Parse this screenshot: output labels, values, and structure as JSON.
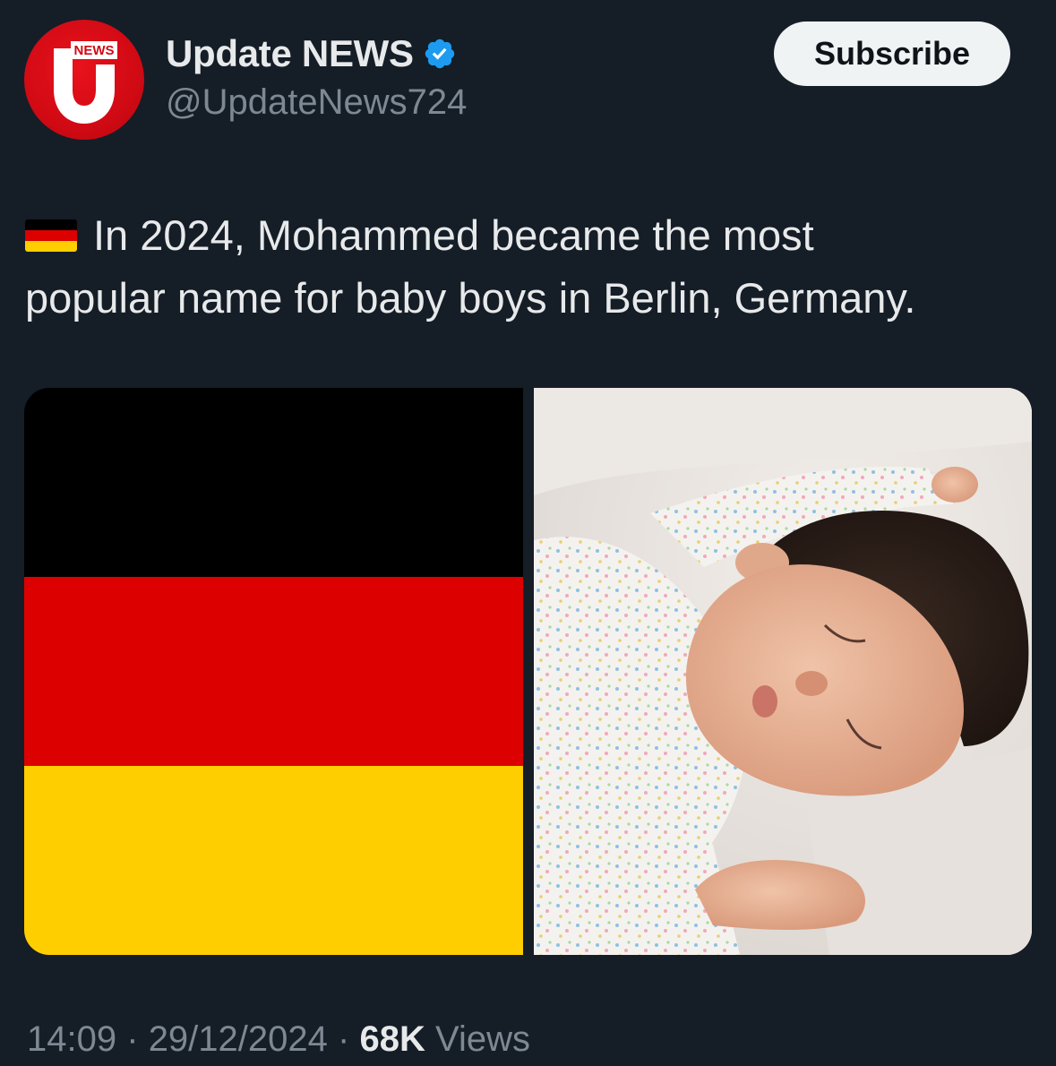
{
  "account": {
    "display_name": "Update NEWS",
    "handle": "@UpdateNews724",
    "verified": true,
    "avatar_text": "NEWS",
    "avatar_letter": "U"
  },
  "actions": {
    "subscribe_label": "Subscribe"
  },
  "post": {
    "flag_emoji": "🇩🇪",
    "text_line1": "In 2024, Mohammed became the most",
    "text_line2": "popular name for baby boys in Berlin, Germany."
  },
  "media": {
    "images": [
      {
        "description": "german-flag",
        "colors": [
          "#000000",
          "#dd0000",
          "#ffce00"
        ]
      },
      {
        "description": "sleeping-baby-photo"
      }
    ]
  },
  "meta": {
    "time": "14:09",
    "date": "29/12/2024",
    "views_count": "68K",
    "views_label": "Views",
    "separator": "·"
  },
  "colors": {
    "background": "#151d27",
    "text_primary": "#e7e9ea",
    "text_secondary": "#7d8893",
    "verified_blue": "#1d9bf0",
    "brand_red": "#d10a14"
  }
}
